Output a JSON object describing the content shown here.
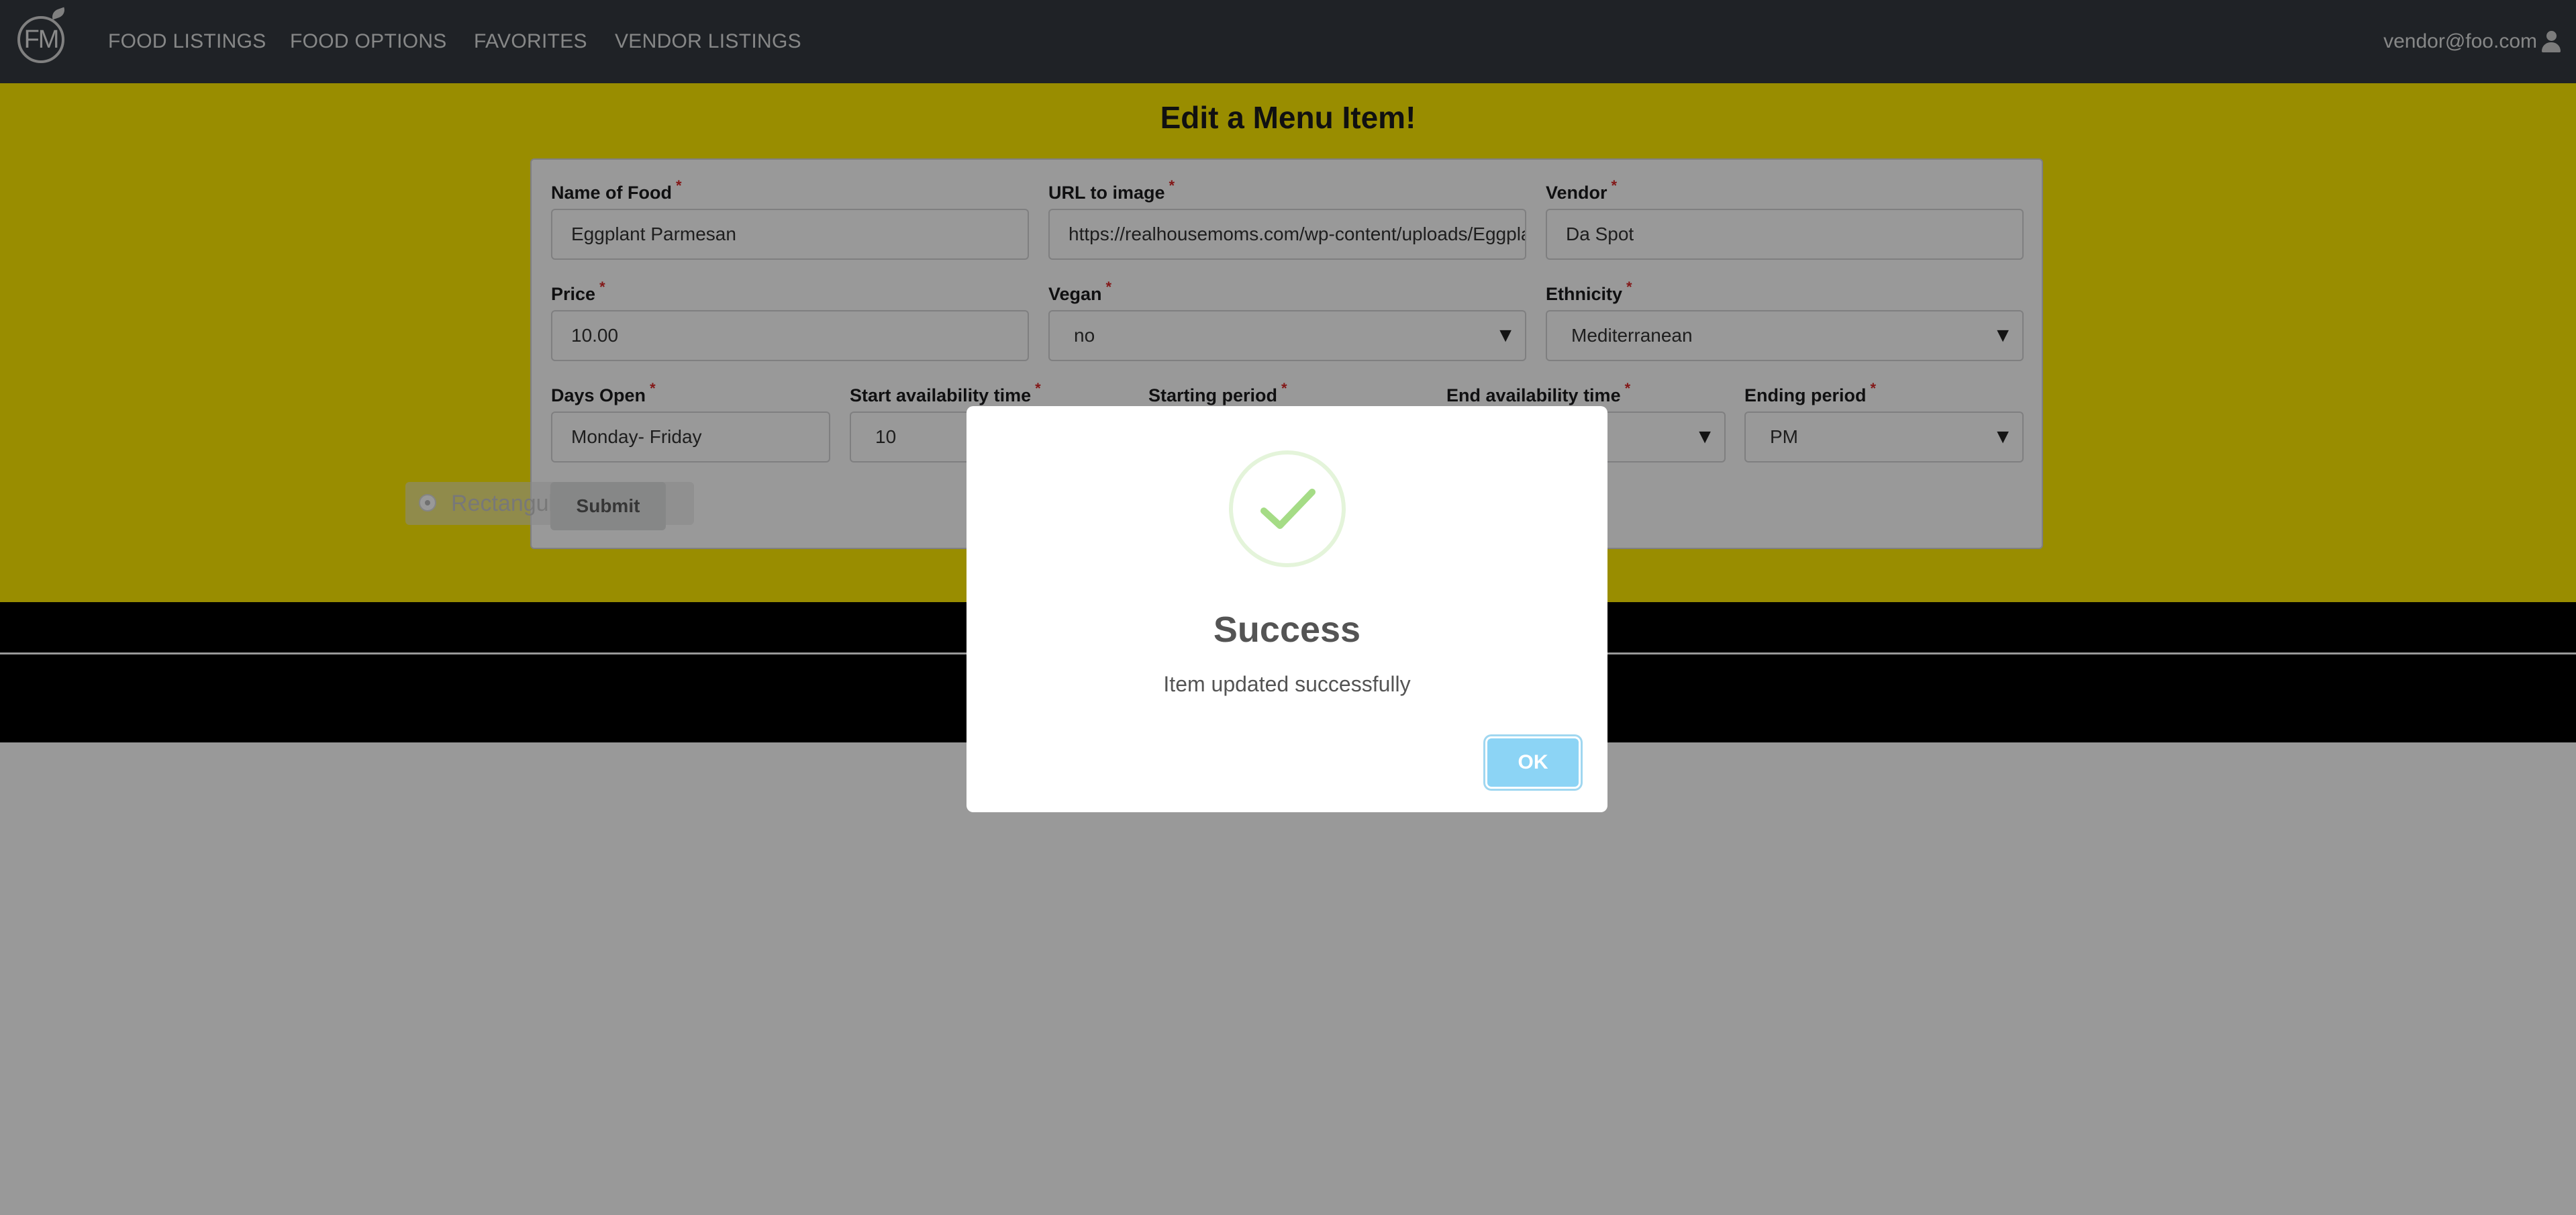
{
  "navbar": {
    "logo_text": "FM",
    "links": [
      "FOOD LISTINGS",
      "FOOD OPTIONS",
      "FAVORITES",
      "VENDOR LISTINGS"
    ],
    "user_email": "vendor@foo.com",
    "user_icon": "user-icon"
  },
  "page": {
    "title": "Edit a Menu Item!"
  },
  "form": {
    "required_marker": "*",
    "name_of_food": {
      "label": "Name of Food",
      "value": "Eggplant Parmesan"
    },
    "url_to_image": {
      "label": "URL to image",
      "value": "https://realhousemoms.com/wp-content/uploads/Eggplant-Parmesan"
    },
    "vendor": {
      "label": "Vendor",
      "value": "Da Spot"
    },
    "price": {
      "label": "Price",
      "value": "10.00"
    },
    "vegan": {
      "label": "Vegan",
      "value": "no"
    },
    "ethnicity": {
      "label": "Ethnicity",
      "value": "Mediterranean"
    },
    "days_open": {
      "label": "Days Open",
      "value": "Monday- Friday"
    },
    "start_time": {
      "label": "Start availability time",
      "value": "10"
    },
    "starting_period": {
      "label": "Starting period"
    },
    "end_time": {
      "label": "End availability time"
    },
    "ending_period": {
      "label": "Ending period",
      "value": "PM"
    },
    "submit_label": "Submit",
    "ghost_radio_label": "Rectangular"
  },
  "modal": {
    "title": "Success",
    "text": "Item updated successfully",
    "ok_label": "OK",
    "icon": "check-icon",
    "accent": "#a5dc86",
    "button_color": "#8cd4f5"
  },
  "colors": {
    "navbar": "#343a40",
    "banner": "#ffeb00",
    "footer": "#000000"
  }
}
